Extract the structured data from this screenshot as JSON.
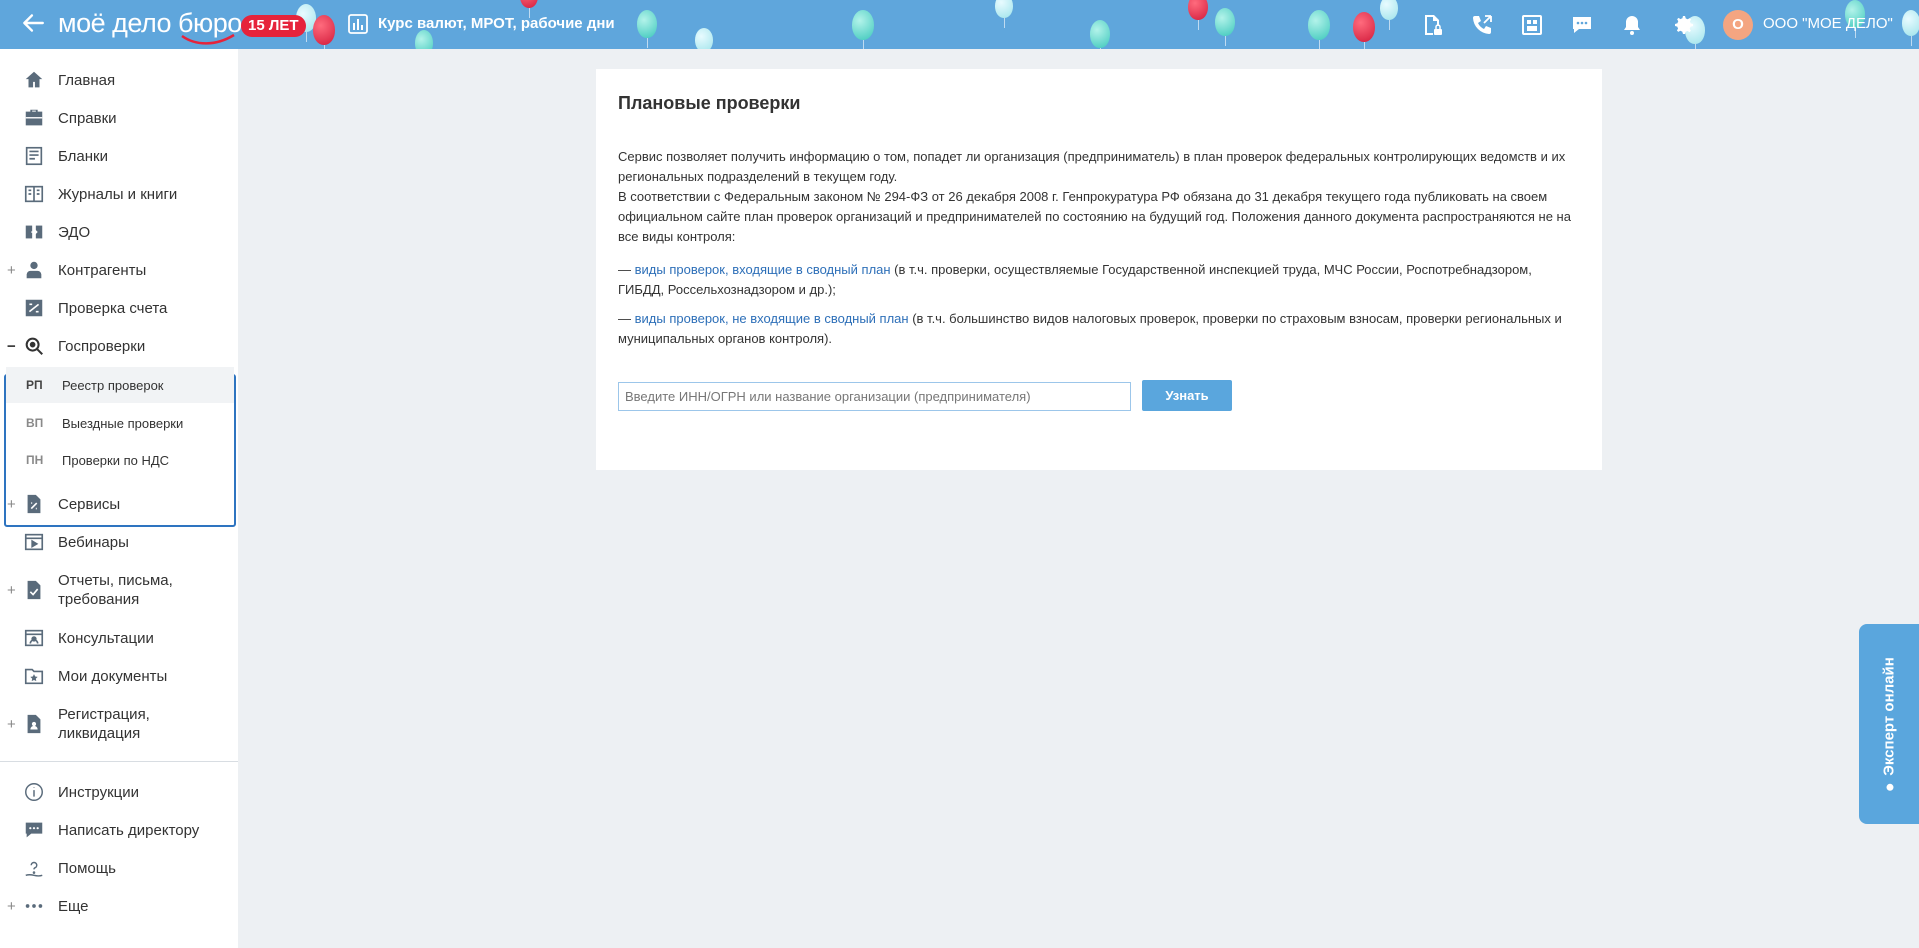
{
  "header": {
    "logo": "моё дело бюро",
    "anniversary_badge": "15 ЛЕТ",
    "rates_link": "Курс валют, МРОТ, рабочие дни",
    "avatar_initial": "О",
    "org_name": "ООО \"МОЕ ДЕЛО\"",
    "icons": [
      "document-lock-icon",
      "phone-icon",
      "building-icon",
      "chat-icon",
      "bell-icon",
      "gear-icon"
    ],
    "colors": {
      "background": "#5fa6dc",
      "badge": "#e6233b",
      "avatar": "#f4a581"
    }
  },
  "sidebar": {
    "items": [
      {
        "label": "Главная",
        "icon": "home-icon",
        "expandable": false
      },
      {
        "label": "Справки",
        "icon": "briefcase-icon",
        "expandable": false
      },
      {
        "label": "Бланки",
        "icon": "form-icon",
        "expandable": false
      },
      {
        "label": "Журналы и книги",
        "icon": "book-icon",
        "expandable": false
      },
      {
        "label": "ЭДО",
        "icon": "edo-icon",
        "expandable": false
      },
      {
        "label": "Контрагенты",
        "icon": "contractors-icon",
        "expandable": true
      },
      {
        "label": "Проверка счета",
        "icon": "account-check-icon",
        "expandable": false
      },
      {
        "label": "Госпроверки",
        "icon": "inspection-icon",
        "expandable": true,
        "expanded": true
      },
      {
        "label": "Сервисы",
        "icon": "services-icon",
        "expandable": true
      },
      {
        "label": "Вебинары",
        "icon": "webinar-icon",
        "expandable": false
      },
      {
        "label": "Отчеты, письма, требования",
        "icon": "reports-icon",
        "expandable": true
      },
      {
        "label": "Консультации",
        "icon": "consultation-icon",
        "expandable": false
      },
      {
        "label": "Мои документы",
        "icon": "my-documents-icon",
        "expandable": false
      },
      {
        "label": "Регистрация, ликвидация",
        "icon": "registration-icon",
        "expandable": true
      }
    ],
    "sub_items": [
      {
        "abbr": "РП",
        "label": "Реестр проверок",
        "active": true
      },
      {
        "abbr": "ВП",
        "label": "Выездные проверки",
        "active": false
      },
      {
        "abbr": "ПН",
        "label": "Проверки по НДС",
        "active": false
      }
    ],
    "bottom_items": [
      {
        "label": "Инструкции",
        "icon": "info-icon"
      },
      {
        "label": "Написать директору",
        "icon": "message-icon"
      },
      {
        "label": "Помощь",
        "icon": "help-icon"
      },
      {
        "label": "Еще",
        "icon": "more-icon"
      }
    ],
    "active_color": "#2e74c0"
  },
  "main": {
    "title": "Плановые проверки",
    "intro": "Сервис позволяет получить информацию о том, попадет ли организация (предприниматель) в план проверок федеральных контролирующих ведомств и их региональных подразделений в текущем году.",
    "law_text": "В соответствии с Федеральным законом № 294-ФЗ от 26 декабря 2008 г. Генпрокуратура РФ обязана до 31 декабря текущего года публиковать на своем официальном сайте план проверок организаций и предпринимателей по состоянию на будущий год. Положения данного документа распространяются не на все виды контроля:",
    "bullet_prefix": "— ",
    "bullet1_link": "виды проверок, входящие в сводный план",
    "bullet1_text": " (в т.ч. проверки, осуществляемые Государственной инспекцией труда, МЧС России, Роспотребнадзором, ГИБДД, Россельхознадзором и др.);",
    "bullet2_link": "виды проверок, не входящие в сводный план",
    "bullet2_text": " (в т.ч. большинство видов налоговых проверок, проверки по страховым взносам, проверки региональных и муниципальных органов контроля).",
    "search_value": "",
    "search_placeholder": "Введите ИНН/ОГРН или название организации (предпринимателя)",
    "submit_label": "Узнать",
    "link_color": "#2d6fb8",
    "button_color": "#5aa6dd"
  },
  "expert_tab": {
    "label": "Эксперт онлайн"
  }
}
